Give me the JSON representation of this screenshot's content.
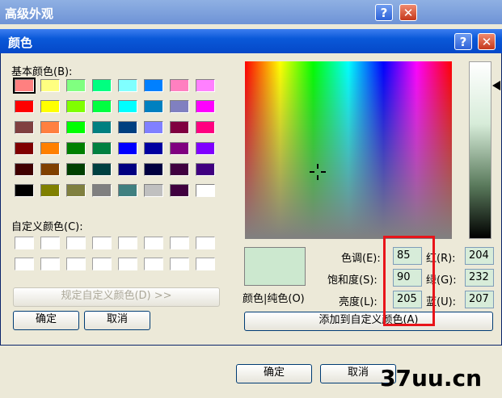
{
  "background_dialog": {
    "title": "高级外观",
    "ok": "确定",
    "cancel": "取消"
  },
  "dialog": {
    "title": "颜色",
    "basic_colors_label": "基本颜色(B):",
    "custom_colors_label": "自定义颜色(C):",
    "define_custom_button": "规定自定义颜色(D) >>",
    "ok": "确定",
    "cancel": "取消",
    "color_solid_label": "颜色|纯色(O)",
    "add_custom_button": "添加到自定义颜色(A)",
    "hue_label": "色调(E):",
    "hue_value": "85",
    "sat_label": "饱和度(S):",
    "sat_value": "90",
    "lum_label": "亮度(L):",
    "lum_value": "205",
    "red_label": "红(R):",
    "red_value": "204",
    "green_label": "绿(G):",
    "green_value": "232",
    "blue_label": "蓝(U):",
    "blue_value": "207",
    "preview_color": "#cce8cf"
  },
  "basic_colors": [
    "#ff8080",
    "#ffff80",
    "#80ff80",
    "#00ff80",
    "#80ffff",
    "#0080ff",
    "#ff80c0",
    "#ff80ff",
    "#ff0000",
    "#ffff00",
    "#80ff00",
    "#00ff40",
    "#00ffff",
    "#0080c0",
    "#8080c0",
    "#ff00ff",
    "#804040",
    "#ff8040",
    "#00ff00",
    "#008080",
    "#004080",
    "#8080ff",
    "#800040",
    "#ff0080",
    "#800000",
    "#ff8000",
    "#008000",
    "#008040",
    "#0000ff",
    "#0000a0",
    "#800080",
    "#8000ff",
    "#400000",
    "#804000",
    "#004000",
    "#004040",
    "#000080",
    "#000040",
    "#400040",
    "#400080",
    "#000000",
    "#808000",
    "#808040",
    "#808080",
    "#408080",
    "#c0c0c0",
    "#400040",
    "#ffffff"
  ],
  "watermark": "37uu.cn"
}
